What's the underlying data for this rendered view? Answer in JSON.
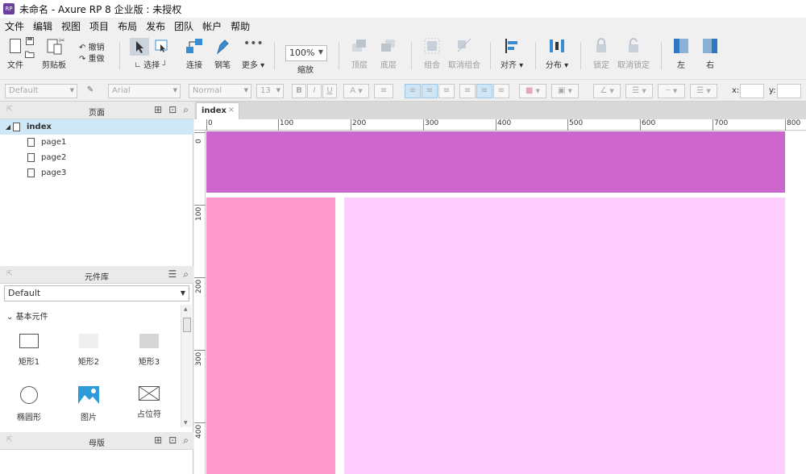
{
  "window": {
    "app_icon": "RP",
    "title": "未命名 - Axure RP 8 企业版 : 未授权"
  },
  "menu": [
    "文件",
    "编辑",
    "视图",
    "项目",
    "布局",
    "发布",
    "团队",
    "帐户",
    "帮助"
  ],
  "toolbar": {
    "file": "文件",
    "clipboard": "剪贴板",
    "undo": "撤销",
    "redo": "重做",
    "select": "选择",
    "connect": "连接",
    "pen": "钢笔",
    "more": "更多 ▾",
    "zoom_value": "100%",
    "zoom_label": "缩放",
    "top": "顶层",
    "bottom": "底层",
    "group": "组合",
    "ungroup": "取消组合",
    "align": "对齐 ▾",
    "distribute": "分布 ▾",
    "lock": "锁定",
    "unlock": "取消锁定",
    "left": "左",
    "right": "右"
  },
  "format": {
    "style": "Default",
    "font": "Arial",
    "weight": "Normal",
    "size": "13",
    "bold": "B",
    "italic": "I",
    "underline": "U",
    "text_color": "A",
    "x_label": "x:",
    "y_label": "y:"
  },
  "pages_panel": {
    "title": "页面",
    "root": "index",
    "pages": [
      "page1",
      "page2",
      "page3"
    ]
  },
  "library_panel": {
    "title": "元件库",
    "selected_library": "Default",
    "group": "基本元件",
    "widgets": [
      "矩形1",
      "矩形2",
      "矩形3",
      "椭圆形",
      "图片",
      "占位符"
    ]
  },
  "masters_panel": {
    "title": "母版"
  },
  "canvas": {
    "tab": "index",
    "tab_close": "×",
    "h_ruler": [
      "0",
      "100",
      "200",
      "300",
      "400",
      "500",
      "600",
      "700",
      "800"
    ],
    "v_ruler": [
      "0",
      "100",
      "200",
      "300",
      "400"
    ],
    "colors": {
      "header_rect": "#cc66cc",
      "left_rect": "#ff99cc",
      "main_rect": "#ffccff"
    }
  }
}
